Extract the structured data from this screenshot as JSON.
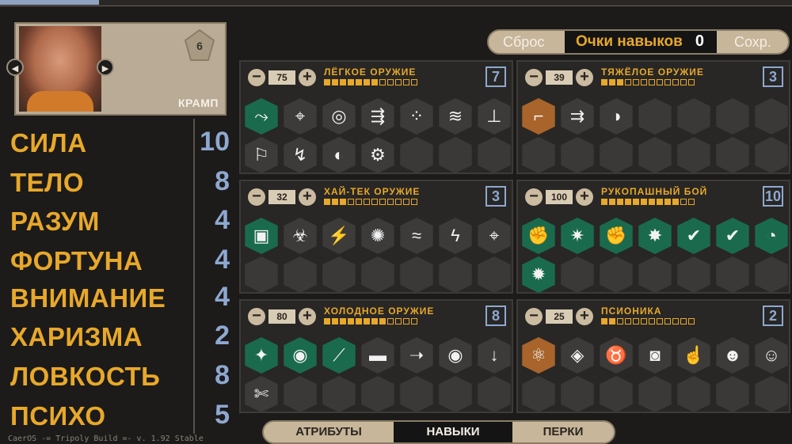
{
  "character": {
    "name": "КРАМП",
    "level": "6"
  },
  "attributes": [
    {
      "name": "СИЛА",
      "value": "10"
    },
    {
      "name": "ТЕЛО",
      "value": "8"
    },
    {
      "name": "РАЗУМ",
      "value": "4"
    },
    {
      "name": "ФОРТУНА",
      "value": "4"
    },
    {
      "name": "ВНИМАНИЕ",
      "value": "4"
    },
    {
      "name": "ХАРИЗМА",
      "value": "2"
    },
    {
      "name": "ЛОВКОСТЬ",
      "value": "8"
    },
    {
      "name": "ПСИХО",
      "value": "5"
    }
  ],
  "controls": {
    "reset": "Сброс",
    "points_label": "Очки навыков",
    "points_value": "0",
    "save": "Сохр."
  },
  "skills": [
    {
      "title": "ЛЁГКОЕ ОРУЖИЕ",
      "value": "75",
      "level": "7",
      "pips_filled": 7,
      "pips_total": 12,
      "cells": [
        {
          "state": "green",
          "icon": "pistol-icon",
          "glyph": "⤳"
        },
        {
          "state": "gray",
          "icon": "crosshair-icon",
          "glyph": "⌖"
        },
        {
          "state": "gray",
          "icon": "target-icon",
          "glyph": "◎"
        },
        {
          "state": "gray",
          "icon": "gun-ammo-icon",
          "glyph": "⇶"
        },
        {
          "state": "gray",
          "icon": "spread-shot-icon",
          "glyph": "⁘"
        },
        {
          "state": "gray",
          "icon": "fast-shot-icon",
          "glyph": "≋"
        },
        {
          "state": "gray",
          "icon": "gun-stand-icon",
          "glyph": "⊥"
        },
        {
          "state": "gray",
          "icon": "ammo-belt-icon",
          "glyph": "⚐"
        },
        {
          "state": "gray",
          "icon": "reload-icon",
          "glyph": "↯"
        },
        {
          "state": "gray",
          "icon": "head-shot-icon",
          "glyph": "◐"
        },
        {
          "state": "gray",
          "icon": "turret-icon",
          "glyph": "⚙"
        },
        {
          "state": "empty"
        },
        {
          "state": "empty"
        },
        {
          "state": "empty"
        }
      ]
    },
    {
      "title": "ТЯЖЁЛОЕ ОРУЖИЕ",
      "value": "39",
      "level": "3",
      "pips_filled": 3,
      "pips_total": 12,
      "cells": [
        {
          "state": "orange",
          "icon": "smg-icon",
          "glyph": "⌐"
        },
        {
          "state": "gray",
          "icon": "shotgun-icon",
          "glyph": "⇉"
        },
        {
          "state": "gray",
          "icon": "blast-icon",
          "glyph": "◑"
        },
        {
          "state": "empty"
        },
        {
          "state": "empty"
        },
        {
          "state": "empty"
        },
        {
          "state": "empty"
        },
        {
          "state": "empty"
        },
        {
          "state": "empty"
        },
        {
          "state": "empty"
        },
        {
          "state": "empty"
        },
        {
          "state": "empty"
        },
        {
          "state": "empty"
        },
        {
          "state": "empty"
        }
      ]
    },
    {
      "title": "ХАЙ-ТЕК ОРУЖИЕ",
      "value": "32",
      "level": "3",
      "pips_filled": 3,
      "pips_total": 12,
      "cells": [
        {
          "state": "green",
          "icon": "chip-icon",
          "glyph": "▣"
        },
        {
          "state": "gray",
          "icon": "biohazard-icon",
          "glyph": "☣"
        },
        {
          "state": "gray",
          "icon": "energy-gun-icon",
          "glyph": "⚡"
        },
        {
          "state": "gray",
          "icon": "burst-icon",
          "glyph": "✺"
        },
        {
          "state": "gray",
          "icon": "heat-icon",
          "glyph": "≈"
        },
        {
          "state": "gray",
          "icon": "lightning-icon",
          "glyph": "ϟ"
        },
        {
          "state": "gray",
          "icon": "scope-icon",
          "glyph": "⌖"
        },
        {
          "state": "empty"
        },
        {
          "state": "empty"
        },
        {
          "state": "empty"
        },
        {
          "state": "empty"
        },
        {
          "state": "empty"
        },
        {
          "state": "empty"
        },
        {
          "state": "empty"
        }
      ]
    },
    {
      "title": "РУКОПАШНЫЙ БОЙ",
      "value": "100",
      "level": "10",
      "pips_filled": 10,
      "pips_total": 12,
      "cells": [
        {
          "state": "green",
          "icon": "double-fist-icon",
          "glyph": "✊"
        },
        {
          "state": "green",
          "icon": "crowd-icon",
          "glyph": "✷"
        },
        {
          "state": "green",
          "icon": "punch-icon",
          "glyph": "✊"
        },
        {
          "state": "green",
          "icon": "knockout-icon",
          "glyph": "✸"
        },
        {
          "state": "green",
          "icon": "counter-icon",
          "glyph": "✔"
        },
        {
          "state": "green",
          "icon": "check-icon",
          "glyph": "✔"
        },
        {
          "state": "green",
          "icon": "dodge-icon",
          "glyph": "◔"
        },
        {
          "state": "green",
          "icon": "shatter-icon",
          "glyph": "✹"
        },
        {
          "state": "empty"
        },
        {
          "state": "empty"
        },
        {
          "state": "empty"
        },
        {
          "state": "empty"
        },
        {
          "state": "empty"
        },
        {
          "state": "empty"
        }
      ]
    },
    {
      "title": "ХОЛОДНОЕ ОРУЖИЕ",
      "value": "80",
      "level": "8",
      "pips_filled": 8,
      "pips_total": 12,
      "cells": [
        {
          "state": "green",
          "icon": "stab-icon",
          "glyph": "✦"
        },
        {
          "state": "green",
          "icon": "eye-slash-icon",
          "glyph": "◉"
        },
        {
          "state": "green",
          "icon": "blade-strike-icon",
          "glyph": "⟋"
        },
        {
          "state": "gray",
          "icon": "knife-icon",
          "glyph": "▬"
        },
        {
          "state": "gray",
          "icon": "thrust-icon",
          "glyph": "➝"
        },
        {
          "state": "gray",
          "icon": "eye-icon",
          "glyph": "◉"
        },
        {
          "state": "gray",
          "icon": "down-arrow-icon",
          "glyph": "↓"
        },
        {
          "state": "gray",
          "icon": "bleed-icon",
          "glyph": "✄"
        },
        {
          "state": "empty"
        },
        {
          "state": "empty"
        },
        {
          "state": "empty"
        },
        {
          "state": "empty"
        },
        {
          "state": "empty"
        },
        {
          "state": "empty"
        }
      ]
    },
    {
      "title": "ПСИОНИКА",
      "value": "25",
      "level": "2",
      "pips_filled": 2,
      "pips_total": 12,
      "cells": [
        {
          "state": "orange",
          "icon": "atom-icon",
          "glyph": "⚛"
        },
        {
          "state": "gray",
          "icon": "psi-eye-icon",
          "glyph": "◈"
        },
        {
          "state": "gray",
          "icon": "horns-icon",
          "glyph": "♉"
        },
        {
          "state": "gray",
          "icon": "mind-wave-icon",
          "glyph": "◙"
        },
        {
          "state": "gray",
          "icon": "hand-icon",
          "glyph": "☝"
        },
        {
          "state": "gray",
          "icon": "mask-icon",
          "glyph": "☻"
        },
        {
          "state": "gray",
          "icon": "dizzy-icon",
          "glyph": "☺"
        },
        {
          "state": "empty"
        },
        {
          "state": "empty"
        },
        {
          "state": "empty"
        },
        {
          "state": "empty"
        },
        {
          "state": "empty"
        },
        {
          "state": "empty"
        },
        {
          "state": "empty"
        }
      ]
    }
  ],
  "tabs": [
    {
      "label": "АТРИБУТЫ",
      "active": false
    },
    {
      "label": "НАВЫКИ",
      "active": true
    },
    {
      "label": "ПЕРКИ",
      "active": false
    }
  ],
  "build_info": "CaerOS -= Tripoly Build =- v. 1.92 Stable"
}
